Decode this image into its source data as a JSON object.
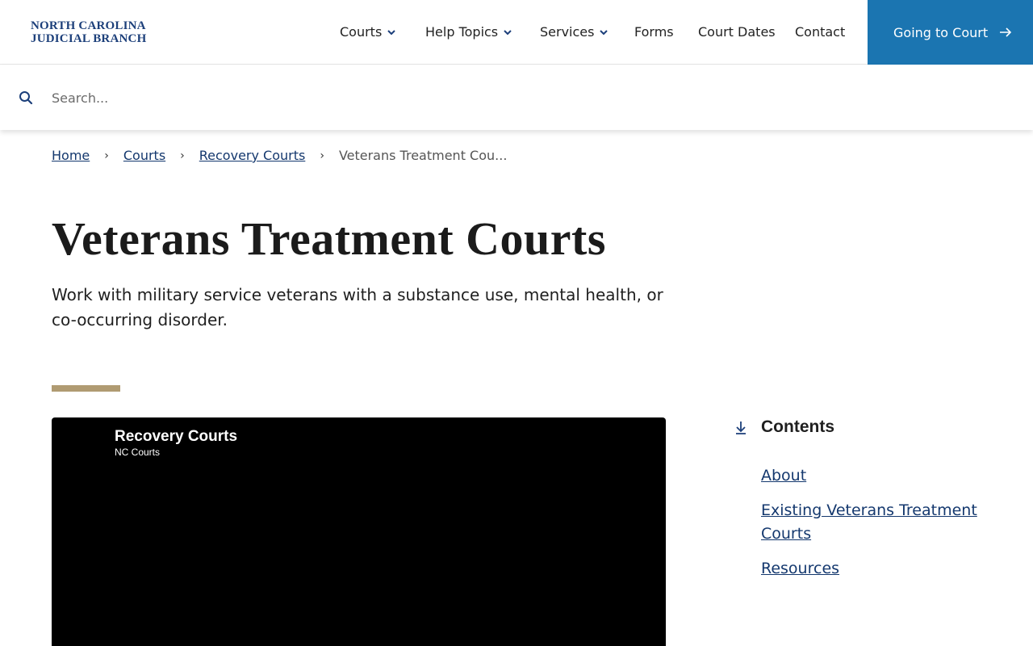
{
  "header": {
    "logo_line1": "NORTH CAROLINA",
    "logo_line2": "JUDICIAL BRANCH",
    "nav": {
      "courts": "Courts",
      "help_topics": "Help Topics",
      "services": "Services",
      "forms": "Forms",
      "court_dates": "Court Dates",
      "contact": "Contact"
    },
    "cta_label": "Going to Court",
    "accent_color": "#1b75b1"
  },
  "search": {
    "placeholder": "Search...",
    "value": ""
  },
  "breadcrumb": {
    "home": "Home",
    "courts": "Courts",
    "recovery": "Recovery Courts",
    "current": "Veterans Treatment Cou..."
  },
  "page": {
    "title": "Veterans Treatment Courts",
    "lede": "Work with military service veterans with a substance use, mental health, or co-occurring disorder.",
    "rule_color": "#b09b72"
  },
  "video": {
    "title": "Recovery Courts",
    "channel": "NC Courts"
  },
  "contents": {
    "heading": "Contents",
    "items": [
      {
        "label": "About"
      },
      {
        "label": "Existing Veterans Treatment Courts"
      },
      {
        "label": "Resources"
      }
    ]
  },
  "icons": [
    "search-icon",
    "chevron-down-icon",
    "arrow-right-icon",
    "chevron-right-icon",
    "download-arrow-icon"
  ]
}
